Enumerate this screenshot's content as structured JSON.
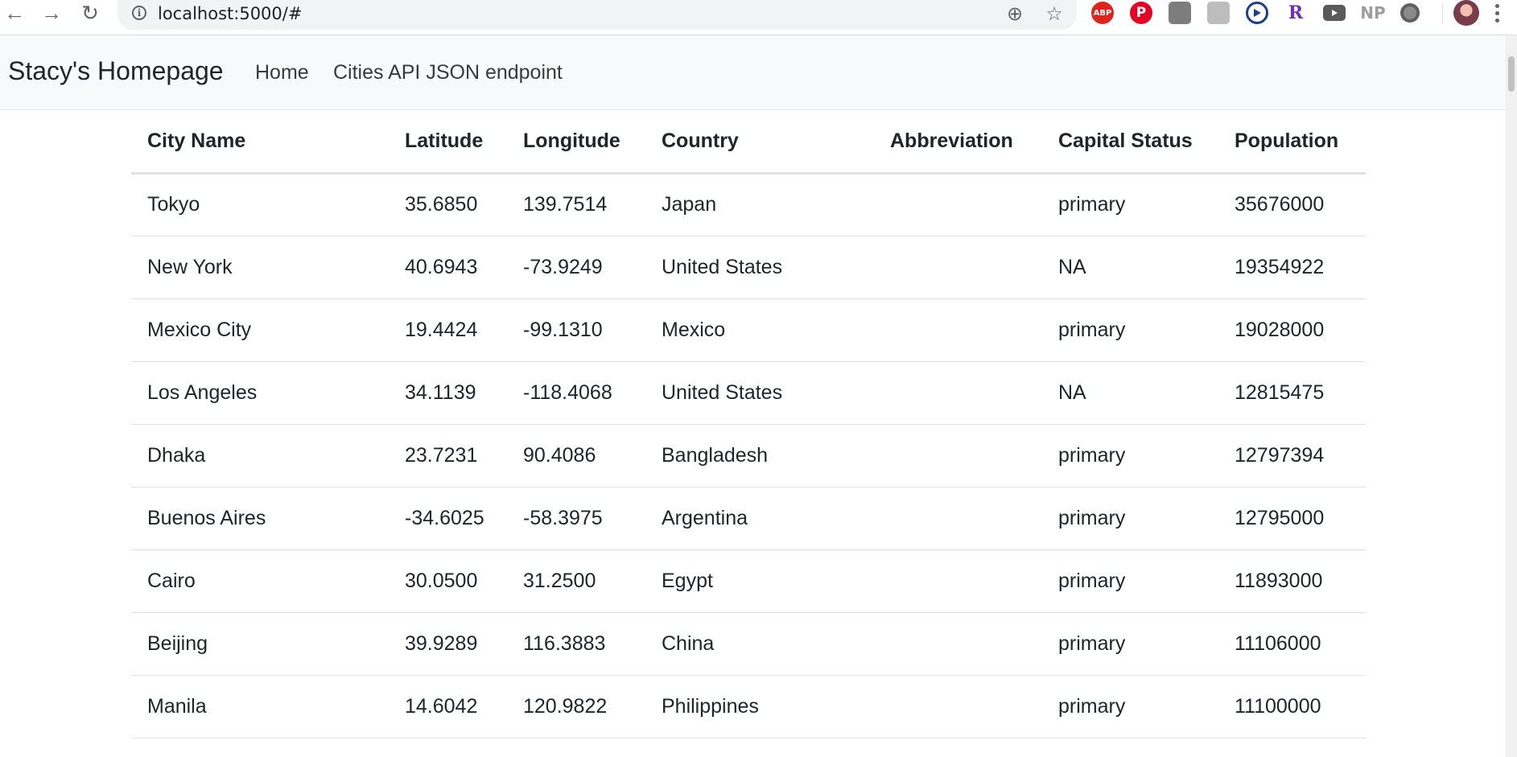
{
  "browser": {
    "back_icon": "←",
    "forward_icon": "→",
    "reload_icon": "↻",
    "url": "localhost:5000/#",
    "zoom_icon": "⊕",
    "star_icon": "☆",
    "extensions": {
      "abp": "ABP",
      "pinterest": "P",
      "np": "NP",
      "r": "R"
    }
  },
  "navbar": {
    "brand": "Stacy's Homepage",
    "links": [
      "Home",
      "Cities API JSON endpoint"
    ]
  },
  "table": {
    "headers": [
      "City Name",
      "Latitude",
      "Longitude",
      "Country",
      "Abbreviation",
      "Capital Status",
      "Population"
    ],
    "rows": [
      [
        "Tokyo",
        "35.6850",
        "139.7514",
        "Japan",
        "",
        "primary",
        "35676000"
      ],
      [
        "New York",
        "40.6943",
        "-73.9249",
        "United States",
        "",
        "NA",
        "19354922"
      ],
      [
        "Mexico City",
        "19.4424",
        "-99.1310",
        "Mexico",
        "",
        "primary",
        "19028000"
      ],
      [
        "Los Angeles",
        "34.1139",
        "-118.4068",
        "United States",
        "",
        "NA",
        "12815475"
      ],
      [
        "Dhaka",
        "23.7231",
        "90.4086",
        "Bangladesh",
        "",
        "primary",
        "12797394"
      ],
      [
        "Buenos Aires",
        "-34.6025",
        "-58.3975",
        "Argentina",
        "",
        "primary",
        "12795000"
      ],
      [
        "Cairo",
        "30.0500",
        "31.2500",
        "Egypt",
        "",
        "primary",
        "11893000"
      ],
      [
        "Beijing",
        "39.9289",
        "116.3883",
        "China",
        "",
        "primary",
        "11106000"
      ],
      [
        "Manila",
        "14.6042",
        "120.9822",
        "Philippines",
        "",
        "primary",
        "11100000"
      ]
    ]
  }
}
